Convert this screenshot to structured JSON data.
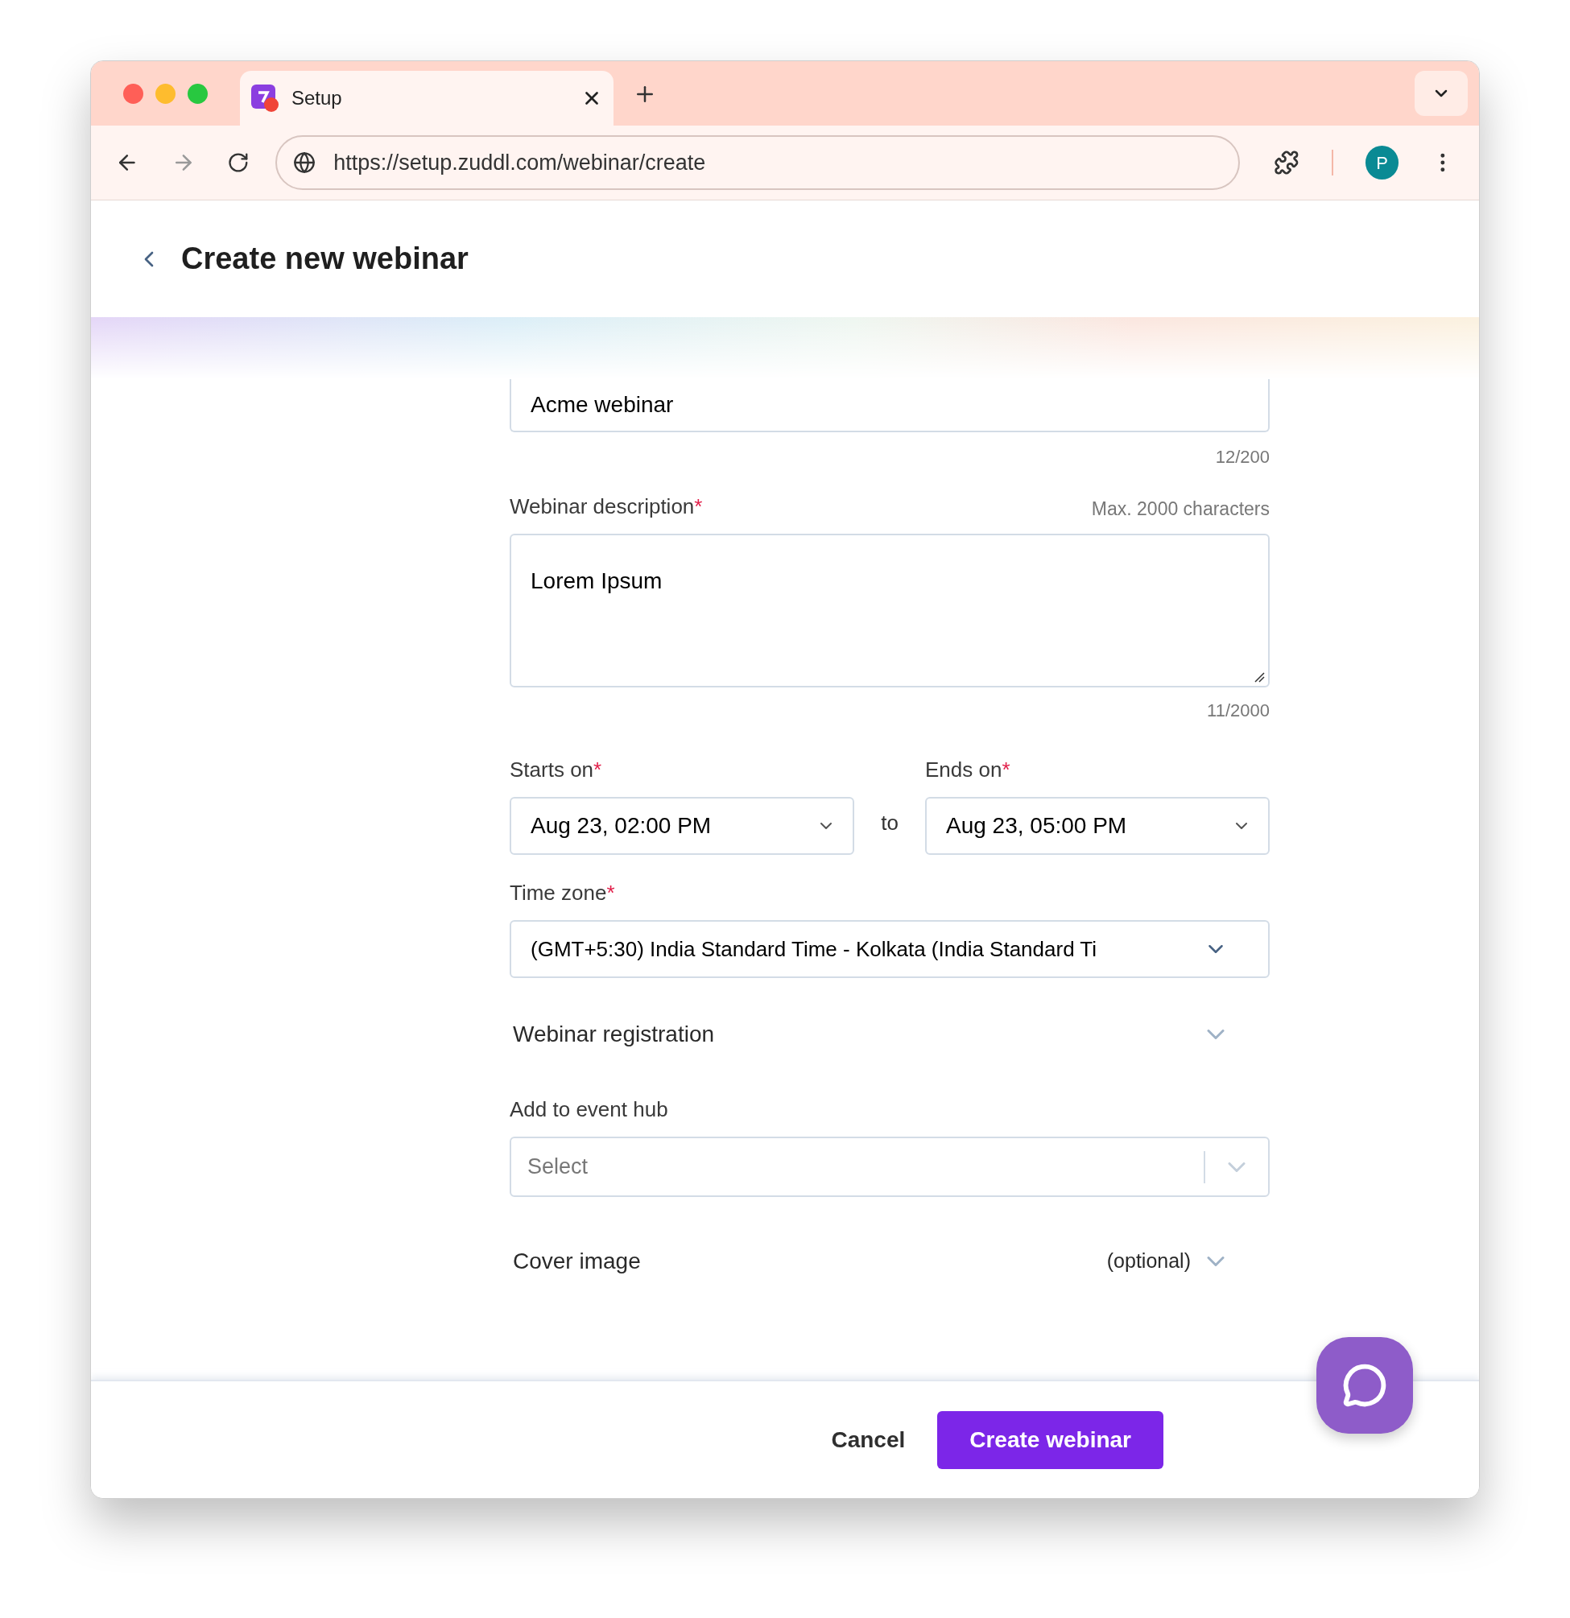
{
  "browser": {
    "tab_title": "Setup",
    "url": "https://setup.zuddl.com/webinar/create",
    "profile_initial": "P"
  },
  "header": {
    "title": "Create new webinar"
  },
  "form": {
    "name_field": {
      "value": "Acme webinar",
      "counter": "12/200"
    },
    "description": {
      "label": "Webinar description",
      "required_mark": "*",
      "hint": "Max. 2000 characters",
      "value": "Lorem Ipsum",
      "counter": "11/2000"
    },
    "starts_on": {
      "label": "Starts on",
      "required_mark": "*",
      "value": "Aug 23, 02:00 PM"
    },
    "range_separator": "to",
    "ends_on": {
      "label": "Ends on",
      "required_mark": "*",
      "value": "Aug 23, 05:00 PM"
    },
    "time_zone": {
      "label": "Time zone",
      "required_mark": "*",
      "value": "(GMT+5:30) India Standard Time - Kolkata (India Standard Ti"
    },
    "sections": [
      {
        "title": "Webinar registration",
        "expanded": false
      }
    ],
    "event_hub": {
      "label": "Add to event hub",
      "placeholder": "Select"
    },
    "cover_image": {
      "title": "Cover image",
      "note": "(optional)",
      "expanded": false
    }
  },
  "footer": {
    "buttons": [
      {
        "label": "Cancel",
        "kind": "secondary"
      },
      {
        "label": "Create webinar",
        "kind": "primary"
      }
    ]
  }
}
